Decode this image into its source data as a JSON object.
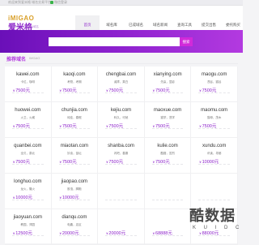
{
  "topbar": {
    "left": "欢迎来到爱米格 域名交易平台",
    "right": "微信登录"
  },
  "logo": {
    "en": "iMIGAO",
    "cn": "爱米格",
    "sub": "域名交易 | 优质精品域名"
  },
  "nav": [
    {
      "label": "首页",
      "active": true
    },
    {
      "label": "域名库",
      "active": false
    },
    {
      "label": "已成域名",
      "active": false
    },
    {
      "label": "域名新闻",
      "active": false
    },
    {
      "label": "查询工具",
      "active": false
    },
    {
      "label": "提交出售",
      "active": false
    },
    {
      "label": "委托购买",
      "active": false
    }
  ],
  "search": {
    "placeholder": "",
    "button": "搜索"
  },
  "section": {
    "title": "推荐域名",
    "sub": "IMGAO"
  },
  "currency": "¥",
  "domains": [
    {
      "name": "kawei.com",
      "desc": "卡位，咖啡",
      "price": "7500元"
    },
    {
      "name": "kaoqi.com",
      "desc": "考勤，考期",
      "price": "7500元"
    },
    {
      "name": "chengbai.com",
      "desc": "诚拜，乘白",
      "price": "7500元"
    },
    {
      "name": "xianying.com",
      "desc": "先赢，显影",
      "price": "7500元"
    },
    {
      "name": "maogu.com",
      "desc": "茂谷，猫谷",
      "price": "7500元"
    },
    {
      "name": "huowei.com",
      "desc": "火卫，火威",
      "price": "7500元"
    },
    {
      "name": "chunjia.com",
      "desc": "纯佳，春假",
      "price": "7500元"
    },
    {
      "name": "kejiu.com",
      "desc": "科久，可就",
      "price": "7500元"
    },
    {
      "name": "maoxue.com",
      "desc": "猫学，茂学",
      "price": "7500元"
    },
    {
      "name": "maomu.com",
      "desc": "猫母，茂木",
      "price": "7500元"
    },
    {
      "name": "quanbei.com",
      "desc": "全贝，泉北",
      "price": "7500元"
    },
    {
      "name": "miaotan.com",
      "desc": "妙谈，苗坛",
      "price": "7500元"
    },
    {
      "name": "shanba.com",
      "desc": "闪吧，善霸",
      "price": "7500元"
    },
    {
      "name": "kulie.com",
      "desc": "酷猎，苦烈",
      "price": "7500元"
    },
    {
      "name": "xundu.com",
      "desc": "讯读，寻都",
      "price": "10000元"
    },
    {
      "name": "longhuo.com",
      "desc": "龙火，隆火",
      "price": "10000元"
    },
    {
      "name": "jiaopao.com",
      "desc": "胶泡，脚跑",
      "price": "10000元"
    },
    {
      "name": "",
      "desc": "",
      "price": ""
    },
    {
      "name": "",
      "desc": "",
      "price": ""
    },
    {
      "name": "",
      "desc": "",
      "price": ""
    },
    {
      "name": "jiaoyuan.com",
      "desc": "教园，郊园",
      "price": "12500元"
    },
    {
      "name": "dianqu.com",
      "desc": "电趣，店区",
      "price": "20000元"
    },
    {
      "name": "",
      "desc": "",
      "price": "20000元"
    },
    {
      "name": "",
      "desc": "",
      "price": "68888元"
    },
    {
      "name": "",
      "desc": "",
      "price": "88000元"
    }
  ],
  "watermark": {
    "text": "酷数据",
    "sub": "K U I D C"
  }
}
